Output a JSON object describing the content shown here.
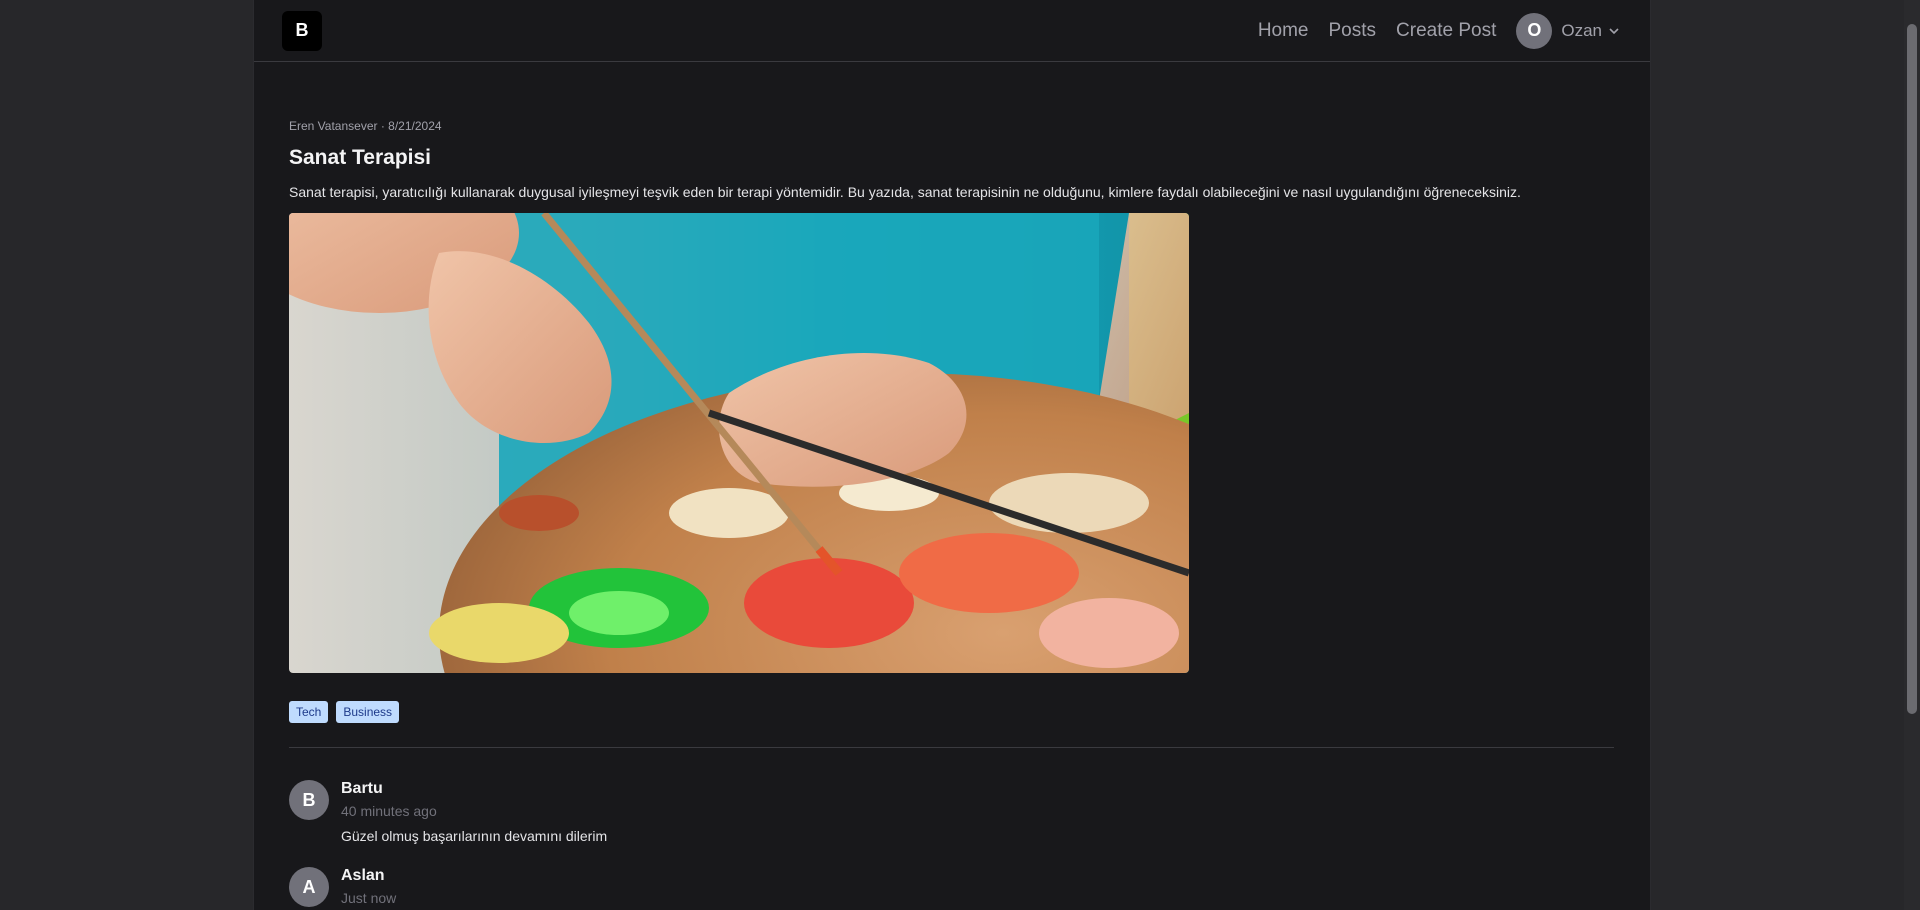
{
  "header": {
    "logo_letter": "B",
    "nav": {
      "home": "Home",
      "posts": "Posts",
      "create": "Create Post"
    },
    "user": {
      "initial": "O",
      "name": "Ozan"
    }
  },
  "post": {
    "meta": "Eren Vatansever · 8/21/2024",
    "title": "Sanat Terapisi",
    "summary": "Sanat terapisi, yaratıcılığı kullanarak duygusal iyileşmeyi teşvik eden bir terapi yöntemidir. Bu yazıda, sanat terapisinin ne olduğunu, kimlere faydalı olabileceğini ve nasıl uygulandığını öğreneceksiniz.",
    "tags": [
      "Tech",
      "Business"
    ]
  },
  "comments": [
    {
      "initial": "B",
      "author": "Bartu",
      "time": "40 minutes ago",
      "text": "Güzel olmuş başarılarının devamını dilerim"
    },
    {
      "initial": "A",
      "author": "Aslan",
      "time": "Just now",
      "text": ""
    }
  ]
}
